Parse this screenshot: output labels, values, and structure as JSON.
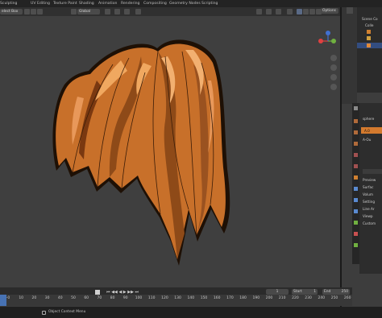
{
  "workspace_tabs": [
    "Sculpting",
    "UV Editing",
    "Texture Paint",
    "Shading",
    "Animation",
    "Rendering",
    "Compositing",
    "Geometry Nodes",
    "Scripting"
  ],
  "toolbar": {
    "select_mode": "elect Box",
    "orientation": "Global",
    "options": "Options"
  },
  "outliner": {
    "header": "Scene Co",
    "row1": "Colle"
  },
  "properties": {
    "object_name": "sphere",
    "material_slot": "A.0",
    "data_field": "A-Ou",
    "sections": [
      "Preview",
      "Surfac",
      "Volum",
      "Setting",
      "Line Ar",
      "Viewp",
      "Custom"
    ]
  },
  "timeline": {
    "current_frame": "1",
    "start_label": "Start",
    "start_value": "1",
    "end_label": "End",
    "end_value": "250",
    "ruler_ticks": [
      "-0",
      "10",
      "20",
      "30",
      "40",
      "50",
      "60",
      "70",
      "80",
      "90",
      "100",
      "110",
      "120",
      "130",
      "140",
      "150",
      "160",
      "170",
      "180",
      "190",
      "200",
      "210",
      "220",
      "230",
      "240",
      "250",
      "260"
    ]
  },
  "status": {
    "context_menu": "Object Context Menu"
  },
  "colors": {
    "hair_base": "#c8702a",
    "hair_highlight": "#f0a860",
    "hair_shadow": "#7a3810",
    "outline": "#1e1005",
    "viewport": "#3f3f3f",
    "axis_x": "#e04040",
    "axis_y": "#70b040",
    "axis_z": "#4070d0"
  }
}
